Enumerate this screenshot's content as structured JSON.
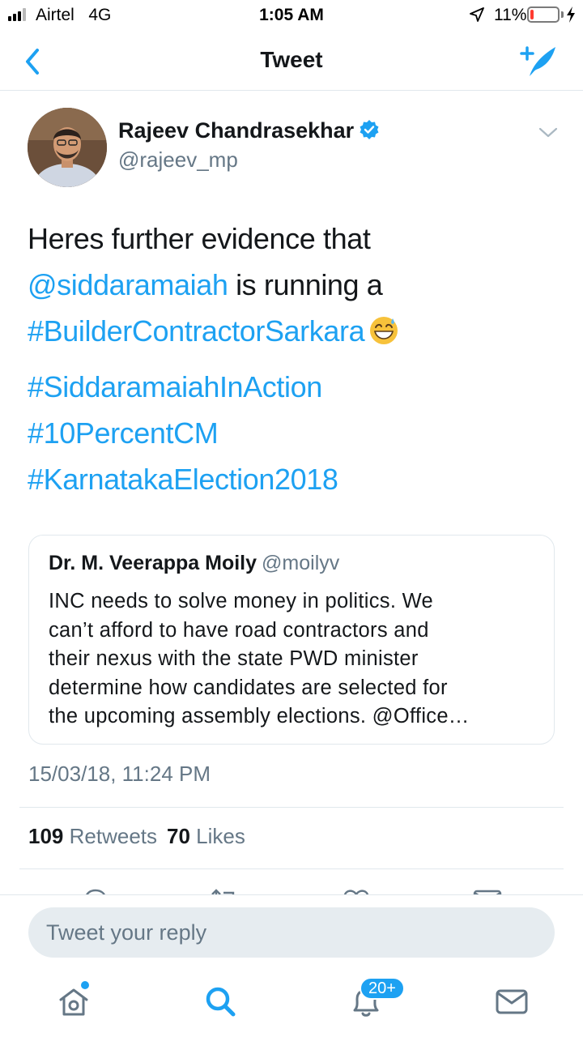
{
  "status_bar": {
    "carrier": "Airtel",
    "network": "4G",
    "time": "1:05 AM",
    "battery_percent": "11%",
    "battery_level": 0.11,
    "battery_color": "#ff3b30"
  },
  "nav": {
    "title": "Tweet",
    "back_icon": "chevron-left-icon",
    "compose_icon": "compose-tweet-icon"
  },
  "tweet": {
    "author_name": "Rajeev Chandrasekhar",
    "author_handle": "@rajeev_mp",
    "verified": true,
    "text_plain_1": "Heres further evidence that",
    "mention": "@siddaramaiah",
    "text_plain_2": " is running a",
    "hashtag_1": "#BuilderContractorSarkara",
    "emoji": "grinning-sweat-emoji",
    "hashtag_2": "#SiddaramaiahInAction",
    "hashtag_3": "#10PercentCM",
    "hashtag_4": "#KarnatakaElection2018",
    "timestamp": "15/03/18, 11:24 PM",
    "retweets_count": "109",
    "retweets_label": "Retweets",
    "likes_count": "70",
    "likes_label": "Likes"
  },
  "quoted_tweet": {
    "author_name": "Dr. M. Veerappa Moily",
    "author_handle": "@moilyv",
    "lines": [
      "INC needs to solve money in politics. We",
      "can’t afford to have road contractors and",
      "their nexus with the state PWD minister",
      "determine how candidates are selected for",
      "the upcoming assembly elections. @Office…"
    ]
  },
  "reply": {
    "placeholder": "Tweet your reply"
  },
  "tabbar": {
    "notifications_badge": "20+"
  },
  "colors": {
    "accent": "#1da1f2",
    "text_secondary": "#657786",
    "divider": "#e1e8ed"
  }
}
